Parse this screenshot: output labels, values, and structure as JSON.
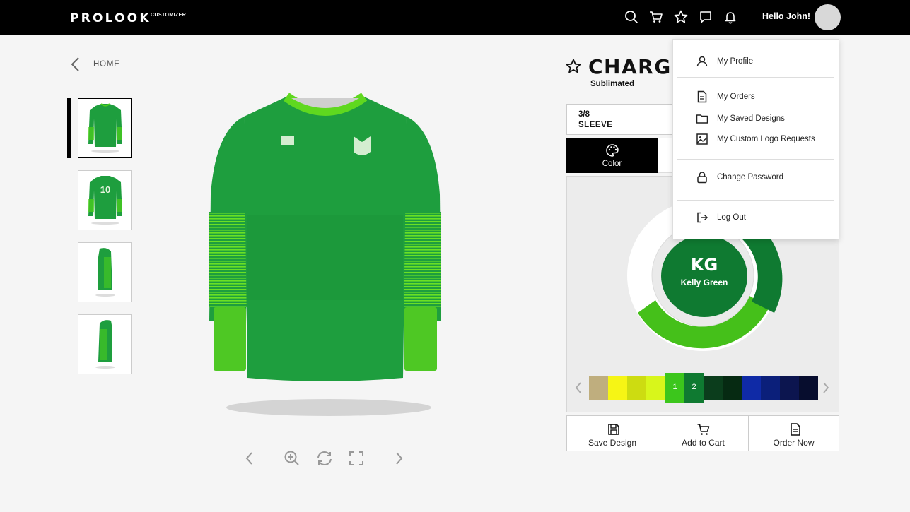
{
  "header": {
    "logo": "PROLOOK",
    "logo_sub": "CUSTOMIZER",
    "greeting": "Hello John!"
  },
  "breadcrumb": {
    "home": "HOME"
  },
  "product": {
    "title": "CHARGEI",
    "subtitle": "Sublimated",
    "jersey_color": "#1e9e3e",
    "accent_color": "#4fd11b"
  },
  "step": {
    "count": "3/8",
    "label": "SLEEVE"
  },
  "tabs": {
    "color": "Color"
  },
  "selected_color": {
    "code": "KG",
    "name": "Kelly Green",
    "hex": "#0f7a31"
  },
  "swatches": [
    {
      "hex": "#bfae7e",
      "label": ""
    },
    {
      "hex": "#f6f515",
      "label": ""
    },
    {
      "hex": "#cddc11",
      "label": ""
    },
    {
      "hex": "#d8f61b",
      "label": ""
    },
    {
      "hex": "#3cc61c",
      "label": "1"
    },
    {
      "hex": "#0f7a31",
      "label": "2"
    },
    {
      "hex": "#0b3d1c",
      "label": ""
    },
    {
      "hex": "#062a12",
      "label": ""
    },
    {
      "hex": "#0f2aa6",
      "label": ""
    },
    {
      "hex": "#0b1f7a",
      "label": ""
    },
    {
      "hex": "#0c154f",
      "label": ""
    },
    {
      "hex": "#070d2e",
      "label": ""
    }
  ],
  "actions": {
    "save": "Save Design",
    "cart": "Add to Cart",
    "order": "Order Now"
  },
  "menu": {
    "profile": "My Profile",
    "orders": "My Orders",
    "saved": "My Saved Designs",
    "logo_requests": "My Custom Logo Requests",
    "password": "Change Password",
    "logout": "Log Out"
  }
}
